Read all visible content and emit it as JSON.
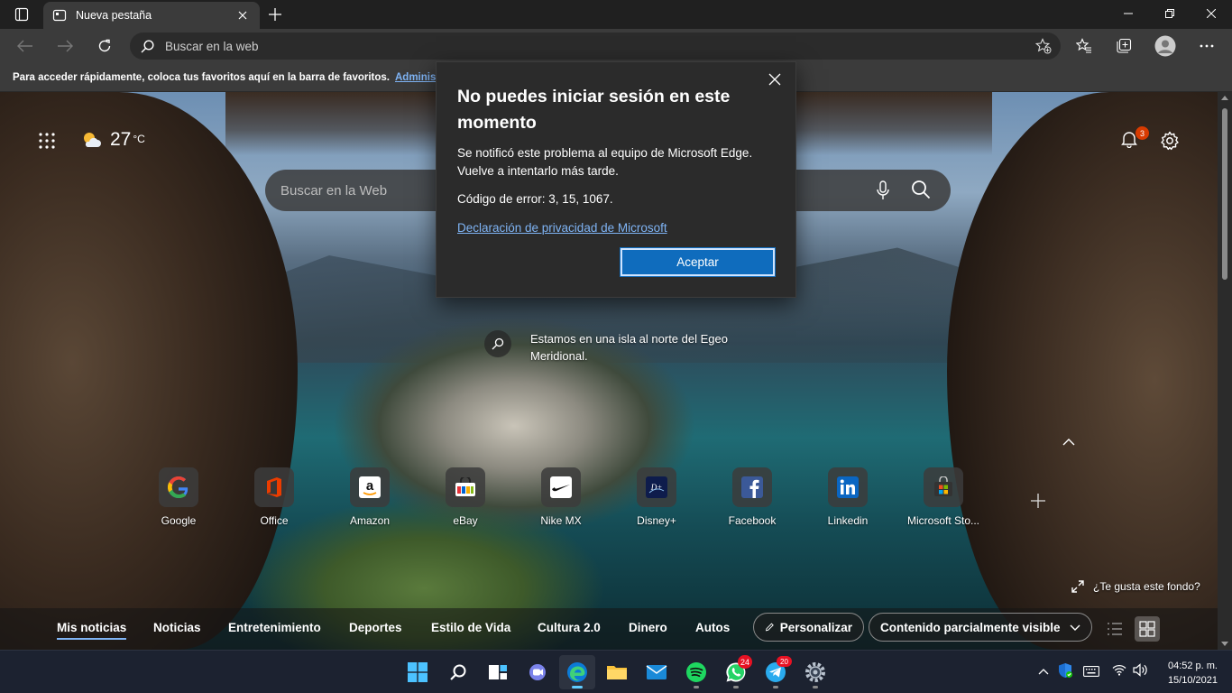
{
  "colors": {
    "accent": "#0f6cbd",
    "link": "#7fb4f5",
    "badge": "#d83b01",
    "frame": "#202020",
    "toolbar": "#3b3b3b",
    "dialog_bg": "#2b2b2b",
    "taskbar": "#1c2230"
  },
  "tab": {
    "title": "Nueva pestaña"
  },
  "address_bar": {
    "placeholder": "Buscar en la web"
  },
  "favorites_bar": {
    "message": "Para acceder rápidamente, coloca tus favoritos aquí en la barra de favoritos.",
    "link": "Administ"
  },
  "weather": {
    "temp": "27",
    "unit": "°C"
  },
  "notifications": {
    "count": "3"
  },
  "search": {
    "placeholder": "Buscar en la Web"
  },
  "image_info": {
    "text": "Estamos en una isla al norte del Egeo Meridional."
  },
  "quick_links": [
    {
      "label": "Google",
      "icon": "google-icon"
    },
    {
      "label": "Office",
      "icon": "office-icon"
    },
    {
      "label": "Amazon",
      "icon": "amazon-icon"
    },
    {
      "label": "eBay",
      "icon": "ebay-icon"
    },
    {
      "label": "Nike MX",
      "icon": "nike-icon"
    },
    {
      "label": "Disney+",
      "icon": "disney-icon"
    },
    {
      "label": "Facebook",
      "icon": "facebook-icon"
    },
    {
      "label": "Linkedin",
      "icon": "linkedin-icon"
    },
    {
      "label": "Microsoft Sto...",
      "icon": "microsoft-store-icon"
    }
  ],
  "background_prompt": "¿Te gusta este fondo?",
  "news_nav": {
    "tabs": [
      "Mis noticias",
      "Noticias",
      "Entretenimiento",
      "Deportes",
      "Estilo de Vida",
      "Cultura 2.0",
      "Dinero",
      "Autos"
    ],
    "active": "Mis noticias",
    "personalize": "Personalizar",
    "visibility": "Contenido parcialmente visible"
  },
  "dialog": {
    "title": "No puedes iniciar sesión en este momento",
    "message": "Se notificó este problema al equipo de Microsoft Edge. Vuelve a intentarlo más tarde.",
    "error_code": "Código de error: 3, 15, 1067.",
    "privacy_link": "Declaración de privacidad de Microsoft",
    "accept": "Aceptar"
  },
  "taskbar": {
    "whatsapp_badge": "24",
    "telegram_badge": "20",
    "time": "04:52 p. m.",
    "date": "15/10/2021"
  }
}
